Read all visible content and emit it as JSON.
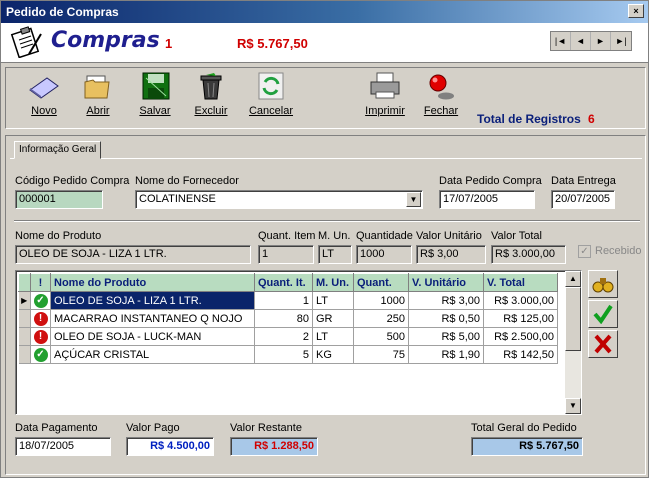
{
  "window": {
    "title": "Pedido de Compras",
    "close_glyph": "×"
  },
  "header": {
    "title": "Compras",
    "record_number": "1",
    "order_total": "R$ 5.767,50",
    "nav": {
      "first": "|◄",
      "prev": "◄",
      "next": "►",
      "last": "►|"
    }
  },
  "toolbar": {
    "novo": "Novo",
    "abrir": "Abrir",
    "salvar": "Salvar",
    "excluir": "Excluir",
    "cancelar": "Cancelar",
    "imprimir": "Imprimir",
    "fechar": "Fechar",
    "total_registros_label": "Total de Registros",
    "total_registros_value": "6"
  },
  "tab": {
    "label": "Informação Geral"
  },
  "form": {
    "codigo_label": "Código Pedido Compra",
    "codigo_value": "000001",
    "fornecedor_label": "Nome do Fornecedor",
    "fornecedor_value": "COLATINENSE",
    "data_pedido_label": "Data Pedido Compra",
    "data_pedido_value": "17/07/2005",
    "data_entrega_label": "Data Entrega",
    "data_entrega_value": "20/07/2005"
  },
  "item": {
    "produto_label": "Nome do Produto",
    "produto_value": "OLEO DE SOJA - LIZA 1 LTR.",
    "quant_item_label": "Quant. Item",
    "quant_item_value": "1",
    "unidade_label": "M. Un.",
    "unidade_value": "LT",
    "quantidade_label": "Quantidade",
    "quantidade_value": "1000",
    "valor_unit_label": "Valor Unitário",
    "valor_unit_value": "R$ 3,00",
    "valor_total_label": "Valor Total",
    "valor_total_value": "R$ 3.000,00",
    "recebido_label": "Recebido",
    "recebido_check": "✓"
  },
  "grid": {
    "columns": {
      "status": "!",
      "produto": "Nome do Produto",
      "quant_it": "Quant. It.",
      "un": "M. Un.",
      "quant": "Quant.",
      "v_unit": "V. Unitário",
      "v_total": "V. Total"
    },
    "rows": [
      {
        "status_glyph": "✓",
        "produto": "OLEO DE SOJA - LIZA 1 LTR.",
        "quant_it": "1",
        "un": "LT",
        "quant": "1000",
        "v_unit": "R$ 3,00",
        "v_total": "R$ 3.000,00"
      },
      {
        "status_glyph": "!",
        "produto": "MACARRAO INSTANTANEO Q NOJO",
        "quant_it": "80",
        "un": "GR",
        "quant": "250",
        "v_unit": "R$ 0,50",
        "v_total": "R$ 125,00"
      },
      {
        "status_glyph": "!",
        "produto": "OLEO DE SOJA - LUCK-MAN",
        "quant_it": "2",
        "un": "LT",
        "quant": "500",
        "v_unit": "R$ 5,00",
        "v_total": "R$ 2.500,00"
      },
      {
        "status_glyph": "✓",
        "produto": "AÇÚCAR CRISTAL",
        "quant_it": "5",
        "un": "KG",
        "quant": "75",
        "v_unit": "R$ 1,90",
        "v_total": "R$ 142,50"
      }
    ],
    "current_row_marker": "▶"
  },
  "footer": {
    "data_pagamento_label": "Data Pagamento",
    "data_pagamento_value": "18/07/2005",
    "valor_pago_label": "Valor Pago",
    "valor_pago_value": "R$ 4.500,00",
    "valor_restante_label": "Valor Restante",
    "valor_restante_value": "R$ 1.288,50",
    "total_geral_label": "Total Geral do Pedido",
    "total_geral_value": "R$ 5.767,50"
  },
  "colors": {
    "title_blue": "#1f1f8f",
    "accent_red": "#d00000",
    "grid_header_green": "#b8dcc0",
    "selection_navy": "#0a246a"
  }
}
